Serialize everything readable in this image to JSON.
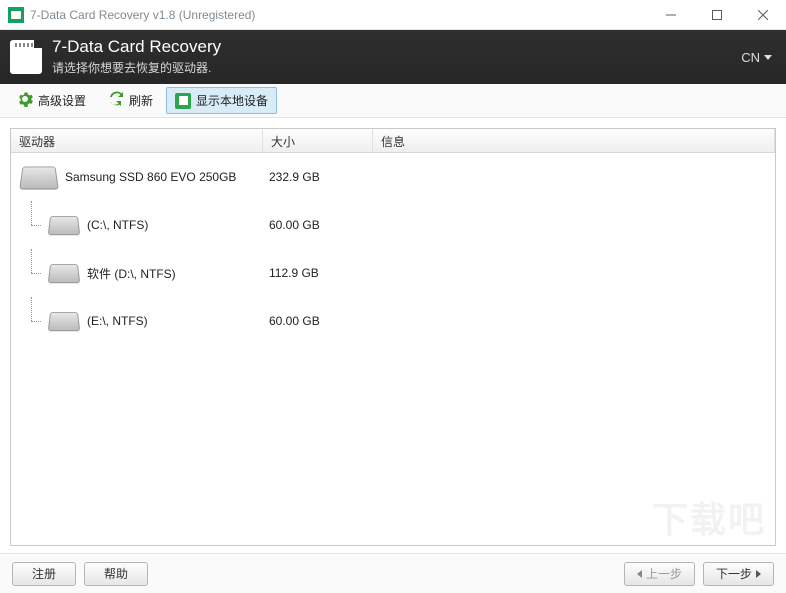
{
  "window": {
    "title": "7-Data Card Recovery v1.8 (Unregistered)"
  },
  "banner": {
    "title": "7-Data Card Recovery",
    "subtitle": "请选择你想要去恢复的驱动器.",
    "lang": "CN"
  },
  "toolbar": {
    "advanced": "高级设置",
    "refresh": "刷新",
    "show_local": "显示本地设备"
  },
  "columns": {
    "drive": "驱动器",
    "size": "大小",
    "info": "信息"
  },
  "drives": [
    {
      "indent": 0,
      "label": "Samsung SSD 860 EVO 250GB",
      "size": "232.9 GB",
      "info": ""
    },
    {
      "indent": 1,
      "label": "(C:\\, NTFS)",
      "size": "60.00 GB",
      "info": ""
    },
    {
      "indent": 1,
      "label": "软件 (D:\\, NTFS)",
      "size": "112.9 GB",
      "info": ""
    },
    {
      "indent": 1,
      "label": "(E:\\, NTFS)",
      "size": "60.00 GB",
      "info": ""
    }
  ],
  "buttons": {
    "register": "注册",
    "help": "帮助",
    "prev": "上一步",
    "next": "下一步"
  },
  "watermark": "下载吧"
}
